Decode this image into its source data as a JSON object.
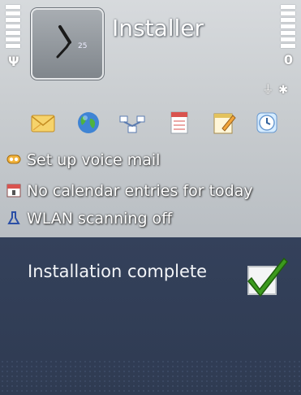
{
  "header": {
    "app_title": "Installer",
    "clock_date": "25",
    "antenna_symbol": "Ψ",
    "battery_value": "0"
  },
  "status_icons": [
    "usb-icon",
    "bluetooth-icon"
  ],
  "shortcuts": [
    {
      "name": "messaging-shortcut",
      "icon": "envelope-icon"
    },
    {
      "name": "web-shortcut",
      "icon": "globe-icon"
    },
    {
      "name": "connectivity-shortcut",
      "icon": "network-icon"
    },
    {
      "name": "notes-shortcut",
      "icon": "notepad-icon"
    },
    {
      "name": "calendar-shortcut",
      "icon": "calendar-edit-icon"
    },
    {
      "name": "clock-shortcut",
      "icon": "clock-icon"
    }
  ],
  "notifications": [
    {
      "label": "Set up voice mail",
      "icon": "voicemail-icon"
    },
    {
      "label": "No calendar entries for today",
      "icon": "calendar-icon"
    },
    {
      "label": "WLAN scanning off",
      "icon": "wlan-icon"
    }
  ],
  "popup": {
    "message": "Installation complete",
    "icon": "checkmark-icon"
  },
  "colors": {
    "top_bg": "#c9cdd1",
    "bottom_bg": "#2f3b52",
    "check_green": "#3c9a1e"
  }
}
